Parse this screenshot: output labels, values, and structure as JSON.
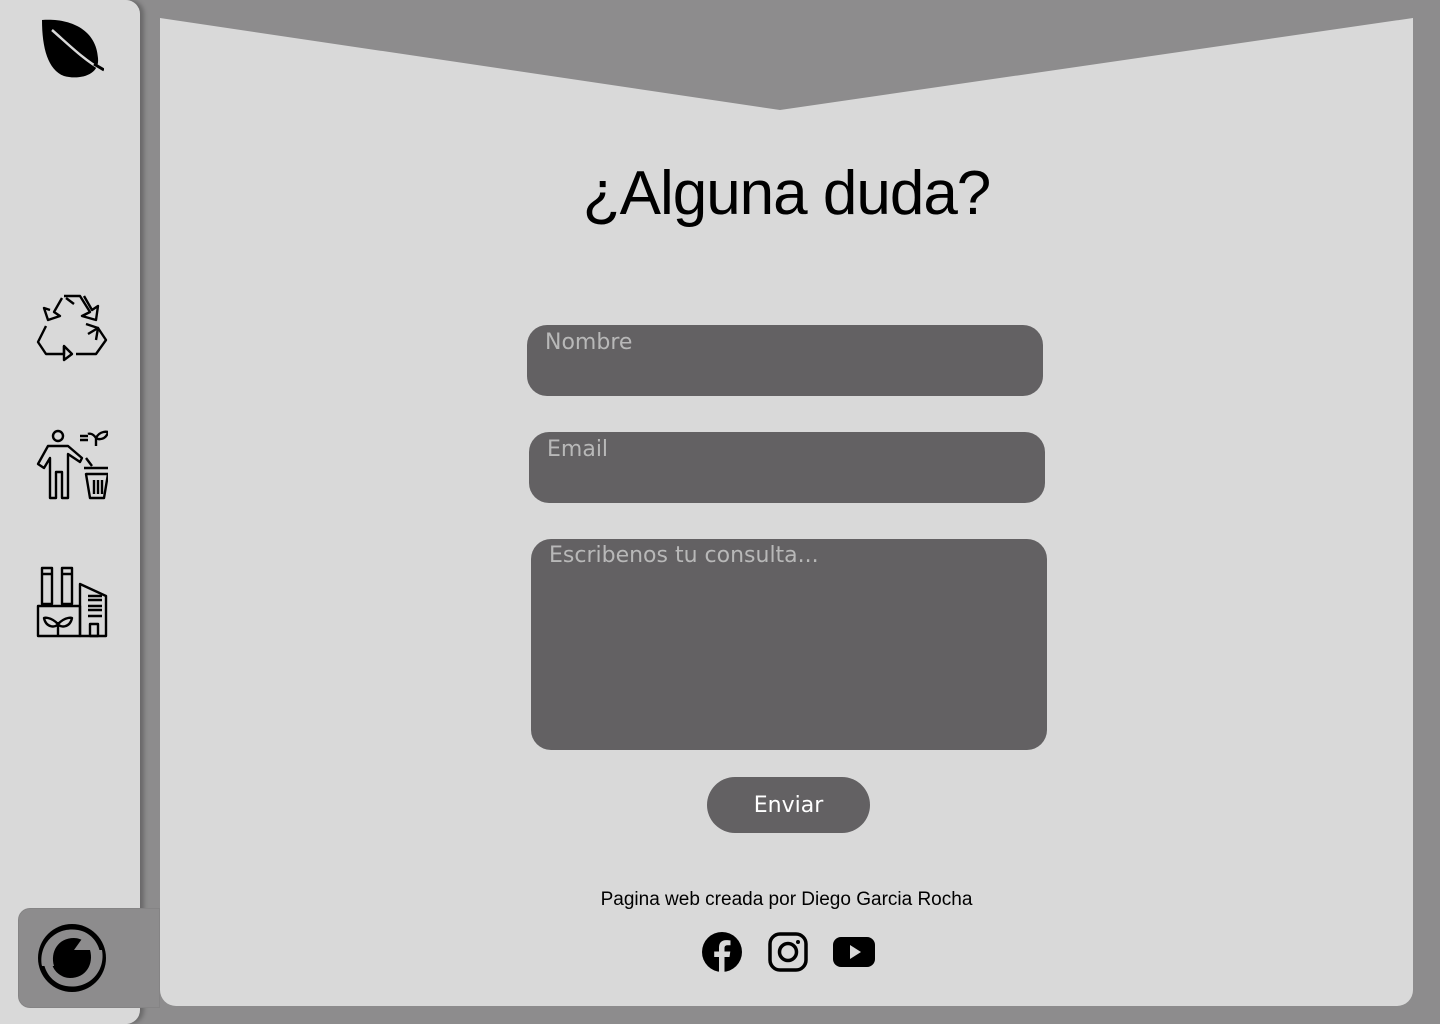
{
  "sidebar": {
    "icons": [
      "leaf-icon",
      "recycle-icon",
      "person-trash-icon",
      "factory-icon"
    ],
    "bottom_icon": "green-dot-recycle-icon"
  },
  "main": {
    "title": "¿Alguna duda?",
    "form": {
      "name_placeholder": "Nombre",
      "email_placeholder": "Email",
      "message_placeholder": "Escribenos tu consulta...",
      "submit_label": "Enviar"
    },
    "footer": {
      "credit": "Pagina web creada por Diego Garcia Rocha",
      "socials": [
        "facebook-icon",
        "instagram-icon",
        "youtube-icon"
      ]
    }
  },
  "colors": {
    "background": "#8d8c8d",
    "panel": "#d9d9d9",
    "field": "#636163"
  }
}
